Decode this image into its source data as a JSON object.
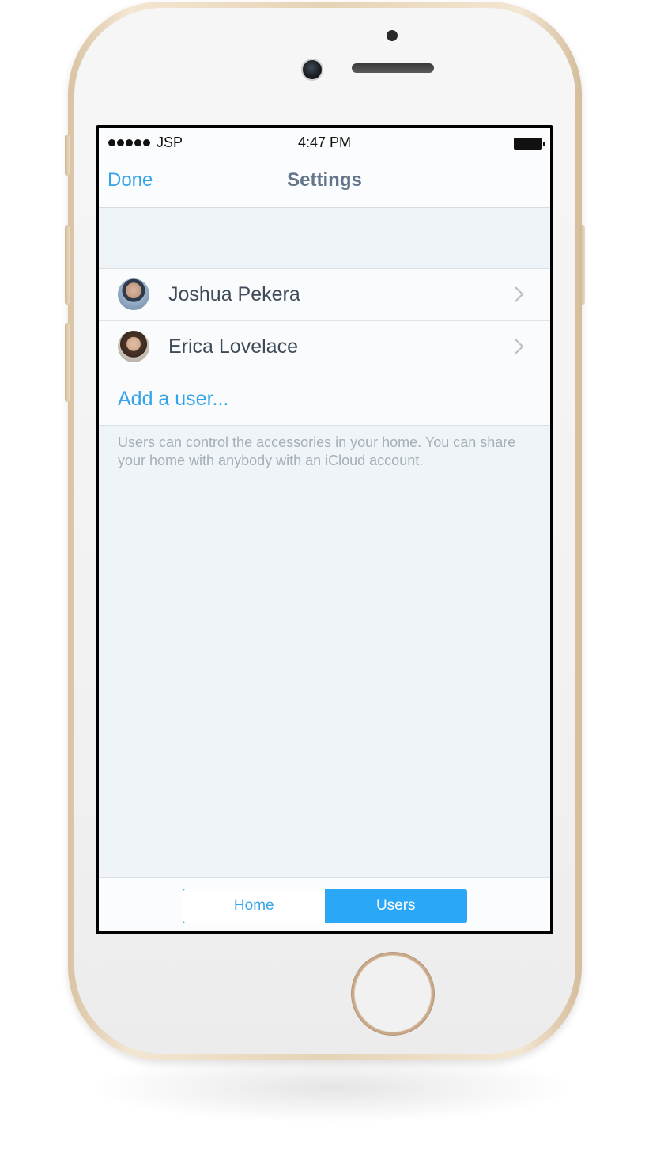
{
  "status_bar": {
    "carrier": "JSP",
    "time": "4:47 PM"
  },
  "nav": {
    "done_label": "Done",
    "title": "Settings"
  },
  "users": [
    {
      "name": "Joshua Pekera"
    },
    {
      "name": "Erica Lovelace"
    }
  ],
  "add_user_label": "Add a user...",
  "footer_note": "Users can control the accessories in your home. You can share your home with anybody with an iCloud account.",
  "segmented_control": {
    "options": [
      "Home",
      "Users"
    ],
    "selected": "Users"
  },
  "colors": {
    "accent": "#35a3ea",
    "selected_segment": "#2aa7f6",
    "background": "#eff4f8"
  }
}
